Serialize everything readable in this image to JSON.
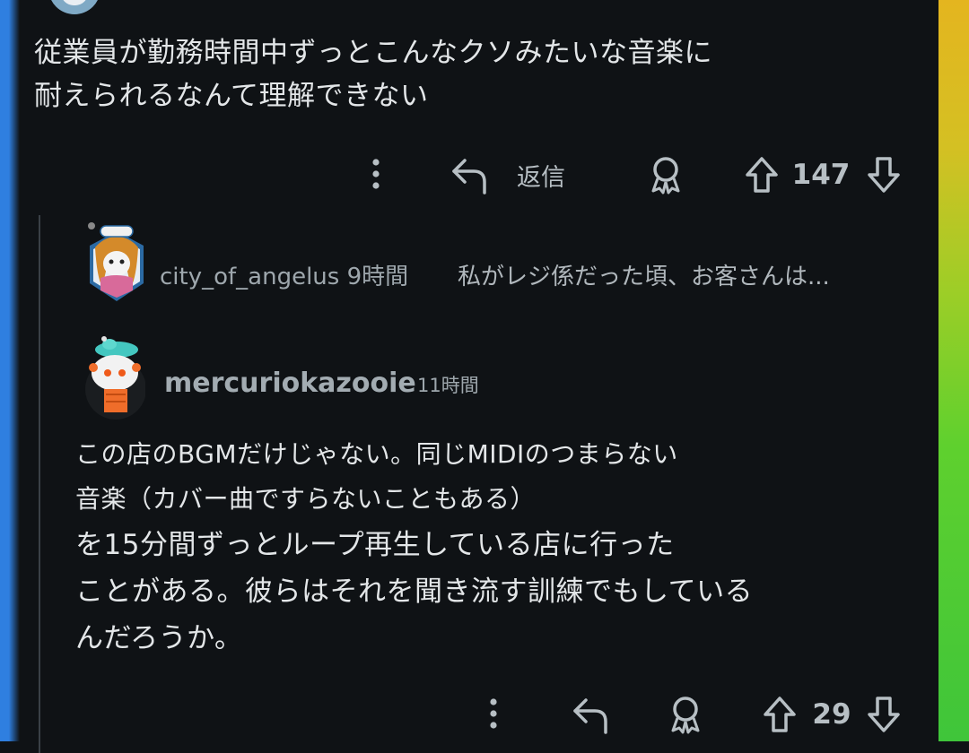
{
  "comment_main": {
    "text_line1": "従業員が勤務時間中ずっとこんなクソみたいな音楽に",
    "text_line2": "耐えられるなんて理解できない",
    "reply_label": "返信",
    "vote_count": "147"
  },
  "collapsed_reply": {
    "username": "city_of_angelus",
    "time": "9時間",
    "preview": "私がレジ係だった頃、お客さんは..."
  },
  "reply": {
    "username": "mercuriokazooie",
    "time": "11時間",
    "line1": "この店のBGMだけじゃない。同じMIDIのつまらない",
    "line2": "音楽（カバー曲ですらないこともある）",
    "line3": "を15分間ずっとループ再生している店に行った",
    "line4": "ことがある。彼らはそれを聞き流す訓練でもしている",
    "line5": "んだろうか。",
    "vote_count": "29"
  },
  "colors": {
    "background": "#0f1215",
    "left_edge": "#2f7fe0",
    "right_edge_top": "#e4b51f",
    "right_edge_bottom": "#3fc53a"
  }
}
